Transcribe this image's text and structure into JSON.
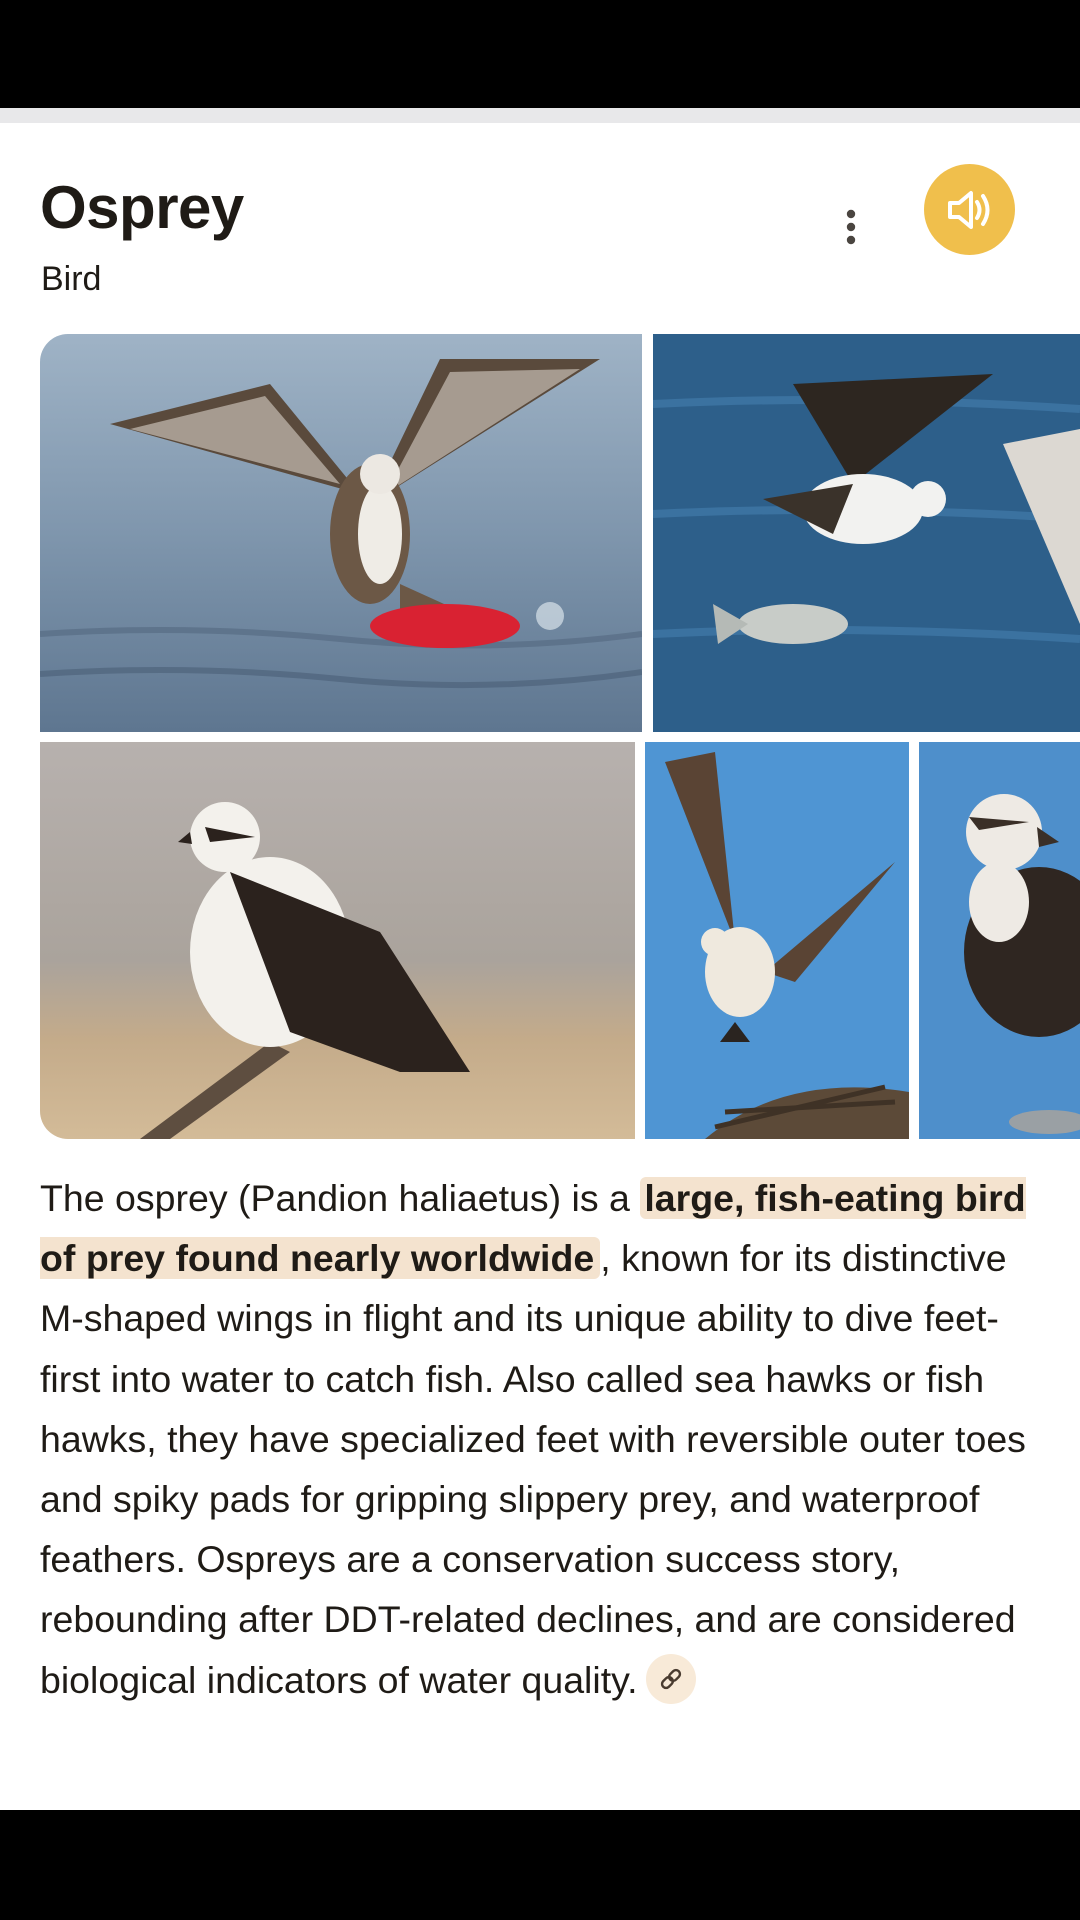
{
  "knowledge_panel": {
    "title": "Osprey",
    "subtitle": "Bird",
    "more_icon": "more-vert-icon",
    "speaker_icon": "volume-icon",
    "accent_color": "#f0bf4c",
    "highlight_color": "#f4e3cf"
  },
  "images": [
    {
      "alt": "osprey lifting a red fish from water"
    },
    {
      "alt": "osprey flying with a fish"
    },
    {
      "alt": "osprey perched on a branch"
    },
    {
      "alt": "osprey flying above a nest"
    },
    {
      "alt": "osprey portrait"
    }
  ],
  "description": {
    "prefix": "The osprey (Pandion haliaetus) is a ",
    "highlight": "large, fish-eating bird of prey found nearly worldwide",
    "suffix": ", known for its distinctive M-shaped wings in flight and its unique ability to dive feet-first into water to catch fish. Also called sea hawks or fish hawks, they have specialized feet with reversible outer toes and spiky pads for gripping slippery prey, and waterproof feathers. Ospreys are a conservation success story, rebounding after DDT-related declines, and are considered biological indicators of water quality.",
    "link_icon": "link-icon"
  }
}
